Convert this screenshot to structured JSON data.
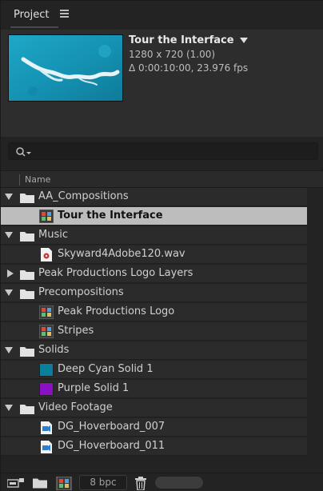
{
  "header": {
    "title": "Project",
    "menu_icon": "hamburger-icon"
  },
  "preview": {
    "comp_name": "Tour the Interface",
    "resolution": "1280 x 720 (1.00)",
    "duration_fps": "Δ 0:00:10:00, 23.976 fps"
  },
  "search": {
    "icon": "search-icon",
    "placeholder": ""
  },
  "columns": {
    "name": "Name"
  },
  "items": [
    {
      "label": "AA_Compositions",
      "type": "folder",
      "expanded": true
    },
    {
      "label": "Tour the Interface",
      "type": "composition",
      "selected": true
    },
    {
      "label": "Music",
      "type": "folder",
      "expanded": true
    },
    {
      "label": "Skyward4Adobe120.wav",
      "type": "audio"
    },
    {
      "label": "Peak Productions Logo Layers",
      "type": "folder",
      "expanded": false
    },
    {
      "label": "Precompositions",
      "type": "folder",
      "expanded": true
    },
    {
      "label": "Peak Productions Logo",
      "type": "composition"
    },
    {
      "label": "Stripes",
      "type": "composition"
    },
    {
      "label": "Solids",
      "type": "folder",
      "expanded": true
    },
    {
      "label": "Deep Cyan Solid 1",
      "type": "solid",
      "color": "#0a7f9c"
    },
    {
      "label": "Purple Solid 1",
      "type": "solid",
      "color": "#8b10c4"
    },
    {
      "label": "Video Footage",
      "type": "folder",
      "expanded": true
    },
    {
      "label": "DG_Hoverboard_007",
      "type": "footage"
    },
    {
      "label": "DG_Hoverboard_011",
      "type": "footage"
    }
  ],
  "footer": {
    "bit_depth": "8 bpc"
  },
  "colors": {
    "panel_bg": "#232323",
    "row_bg": "#2b2b2b",
    "selected_bg": "#bdbdbd",
    "deep_cyan": "#0a7f9c",
    "purple": "#8b10c4"
  }
}
